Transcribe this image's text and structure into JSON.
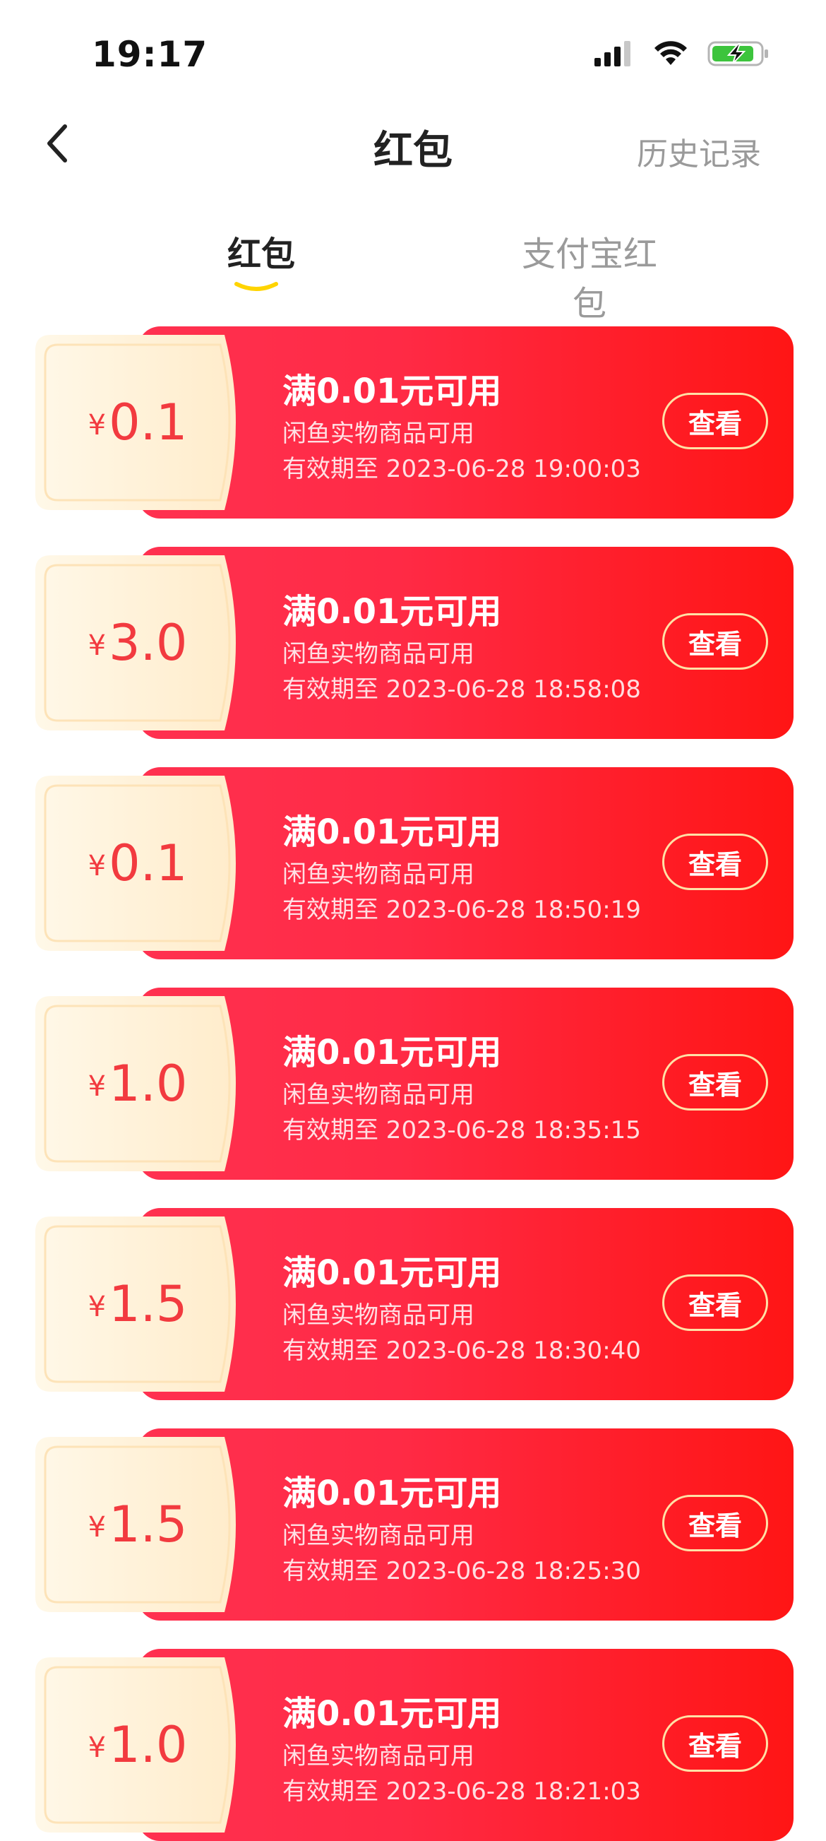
{
  "status_bar": {
    "time": "19:17"
  },
  "nav": {
    "title": "红包",
    "history_label": "历史记录"
  },
  "tabs": [
    {
      "label": "红包",
      "active": true
    },
    {
      "label": "支付宝红包",
      "active": false
    }
  ],
  "colors": {
    "accent_yellow": "#ffd400",
    "coupon_red_start": "#ff3150",
    "coupon_red_end": "#ff1515",
    "amount_red": "#f23a3f",
    "stub_cream": "#fff4dd"
  },
  "coupons": [
    {
      "currency": "¥",
      "amount": "0.1",
      "title": "满0.01元可用",
      "scope": "闲鱼实物商品可用",
      "expiry": "有效期至 2023-06-28 19:00:03",
      "button": "查看"
    },
    {
      "currency": "¥",
      "amount": "3.0",
      "title": "满0.01元可用",
      "scope": "闲鱼实物商品可用",
      "expiry": "有效期至 2023-06-28 18:58:08",
      "button": "查看"
    },
    {
      "currency": "¥",
      "amount": "0.1",
      "title": "满0.01元可用",
      "scope": "闲鱼实物商品可用",
      "expiry": "有效期至 2023-06-28 18:50:19",
      "button": "查看"
    },
    {
      "currency": "¥",
      "amount": "1.0",
      "title": "满0.01元可用",
      "scope": "闲鱼实物商品可用",
      "expiry": "有效期至 2023-06-28 18:35:15",
      "button": "查看"
    },
    {
      "currency": "¥",
      "amount": "1.5",
      "title": "满0.01元可用",
      "scope": "闲鱼实物商品可用",
      "expiry": "有效期至 2023-06-28 18:30:40",
      "button": "查看"
    },
    {
      "currency": "¥",
      "amount": "1.5",
      "title": "满0.01元可用",
      "scope": "闲鱼实物商品可用",
      "expiry": "有效期至 2023-06-28 18:25:30",
      "button": "查看"
    },
    {
      "currency": "¥",
      "amount": "1.0",
      "title": "满0.01元可用",
      "scope": "闲鱼实物商品可用",
      "expiry": "有效期至 2023-06-28 18:21:03",
      "button": "查看"
    }
  ]
}
